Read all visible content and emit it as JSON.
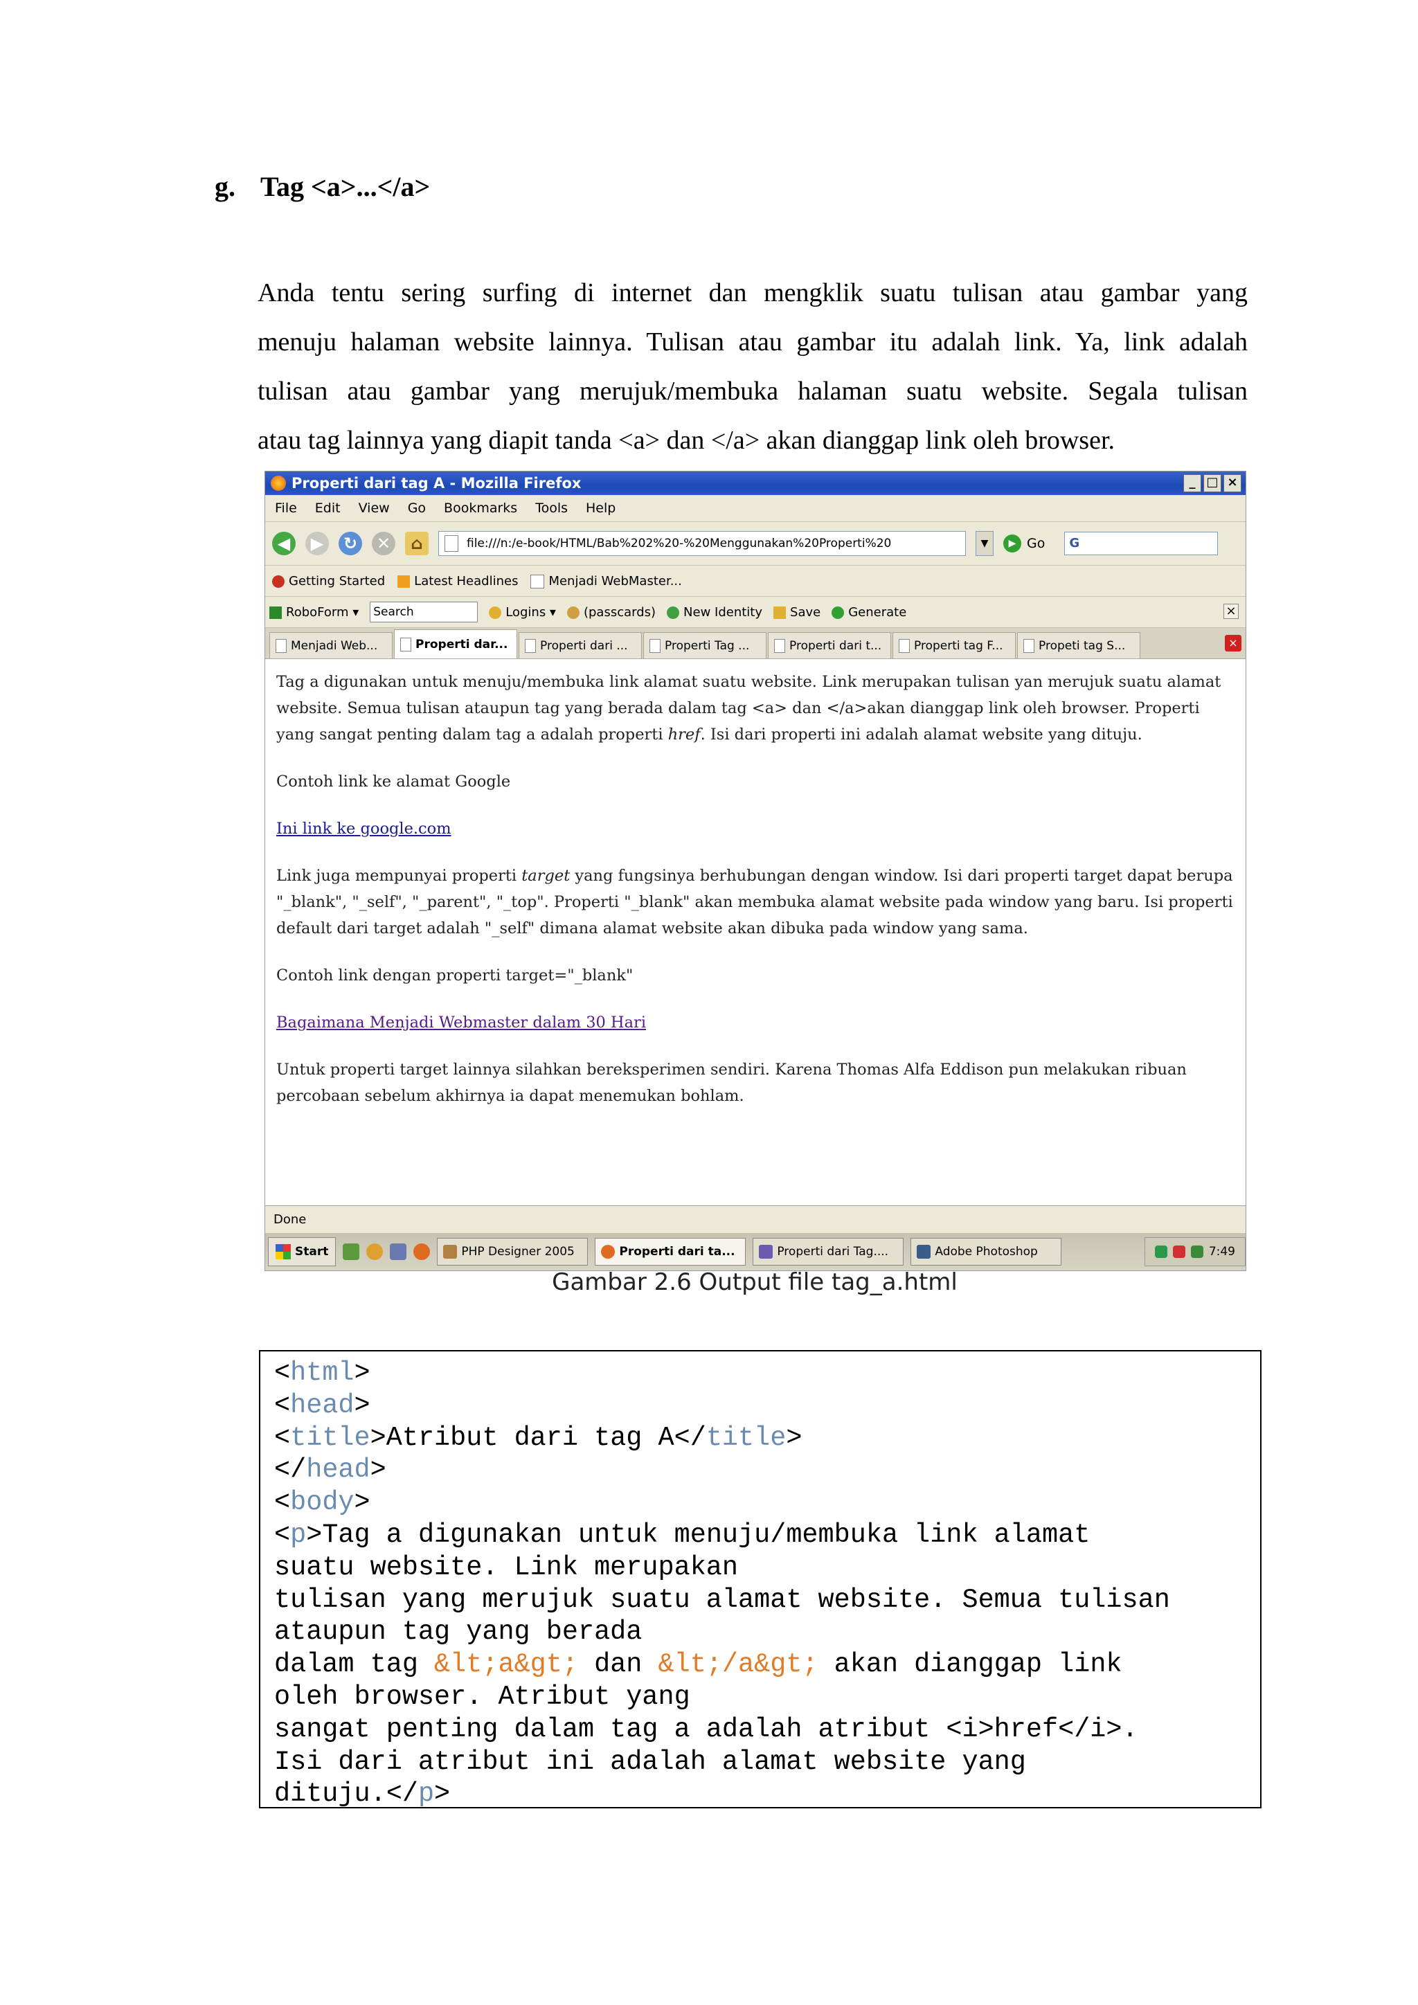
{
  "heading": {
    "marker": "g.",
    "title": "Tag <a>...</a>"
  },
  "paragraph": [
    "Anda tentu sering surfing di internet dan mengklik suatu tulisan atau gambar yang",
    "menuju halaman website lainnya. Tulisan atau gambar itu adalah link. Ya, link adalah",
    "tulisan atau gambar yang merujuk/membuka halaman suatu website. Segala tulisan",
    "atau tag lainnya yang diapit tanda <a> dan </a> akan dianggap link oleh browser."
  ],
  "screenshot": {
    "window_title": "Properti dari tag A - Mozilla Firefox",
    "window_buttons": [
      "_",
      "□",
      "×"
    ],
    "menu": [
      "File",
      "Edit",
      "View",
      "Go",
      "Bookmarks",
      "Tools",
      "Help"
    ],
    "url": "file:///n:/e-book/HTML/Bab%202%20-%20Menggunakan%20Properti%20",
    "go_label": "Go",
    "search_engine_glyph": "G",
    "bookmarks": [
      "Getting Started",
      "Latest Headlines",
      "Menjadi WebMaster..."
    ],
    "roboform": {
      "brand": "RoboForm",
      "search_placeholder": "Search",
      "items": [
        "Logins",
        "(passcards)",
        "New Identity",
        "Save",
        "Generate"
      ]
    },
    "tabs": [
      {
        "label": "Menjadi Web...",
        "active": false
      },
      {
        "label": "Properti dar...",
        "active": true
      },
      {
        "label": "Properti dari ...",
        "active": false
      },
      {
        "label": "Properti Tag ...",
        "active": false
      },
      {
        "label": "Properti dari t...",
        "active": false
      },
      {
        "label": "Properti tag F...",
        "active": false
      },
      {
        "label": "Propeti tag S...",
        "active": false
      }
    ],
    "content": {
      "p1_a": "Tag a digunakan untuk menuju/membuka link alamat suatu website. Link merupakan tulisan yan merujuk suatu alamat website. Semua tulisan ataupun tag yang berada dalam tag <a> dan </a>akan dianggap link oleh browser. Properti yang sangat penting dalam tag a adalah properti ",
      "p1_em": "href",
      "p1_b": ". Isi dari properti ini adalah alamat website yang dituju.",
      "p2": "Contoh link ke alamat Google",
      "link1": "Ini link ke google.com",
      "p3_a": "Link juga mempunyai properti ",
      "p3_em": "target",
      "p3_b": " yang fungsinya berhubungan dengan window. Isi dari properti target dapat berupa \"_blank\", \"_self\", \"_parent\", \"_top\". Properti \"_blank\" akan membuka alamat website pada window yang baru. Isi properti default dari target adalah \"_self\" dimana alamat website akan dibuka pada window yang sama.",
      "p4": "Contoh link dengan properti target=\"_blank\"",
      "link2": "Bagaimana Menjadi Webmaster dalam 30 Hari",
      "p5": "Untuk properti target lainnya silahkan bereksperimen sendiri. Karena Thomas Alfa Eddison pun melakukan ribuan percobaan sebelum akhirnya ia dapat menemukan bohlam."
    },
    "status": "Done",
    "taskbar": {
      "start": "Start",
      "tasks": [
        {
          "label": "PHP Designer 2005",
          "active": false
        },
        {
          "label": "Properti dari ta...",
          "active": true
        },
        {
          "label": "Properti dari Tag....",
          "active": false
        },
        {
          "label": "Adobe Photoshop",
          "active": false
        }
      ],
      "clock": "7:49"
    }
  },
  "caption": "Gambar 2.6 Output file tag_a.html",
  "code": {
    "l1_open": "<",
    "l1_tag": "html",
    "l1_close": ">",
    "l2_open": "<",
    "l2_tag": "head",
    "l2_close": ">",
    "l3_open": "<",
    "l3_tag": "title",
    "l3_mid": ">Atribut dari tag A</",
    "l3_tag2": "title",
    "l3_close": ">",
    "l4_open": "</",
    "l4_tag": "head",
    "l4_close": ">",
    "l5_open": "<",
    "l5_tag": "body",
    "l5_close": ">",
    "l6_open": "<",
    "l6_tag": "p",
    "l6_text": ">Tag a digunakan untuk menuju/membuka link alamat",
    "l7": "suatu website. Link merupakan",
    "l8": "tulisan yang merujuk suatu alamat website. Semua tulisan",
    "l9": "ataupun tag yang berada",
    "l10_a": "dalam tag ",
    "l10_ent1": "&lt;a&gt;",
    "l10_b": " dan ",
    "l10_ent2": "&lt;/a&gt;",
    "l10_c": " akan dianggap link",
    "l11": "oleh browser. Atribut yang",
    "l12": "sangat penting dalam tag a adalah atribut <i>href</i>.",
    "l13": "Isi dari atribut ini adalah alamat website yang",
    "l14_a": "dituju.</",
    "l14_tag": "p",
    "l14_close": ">"
  }
}
